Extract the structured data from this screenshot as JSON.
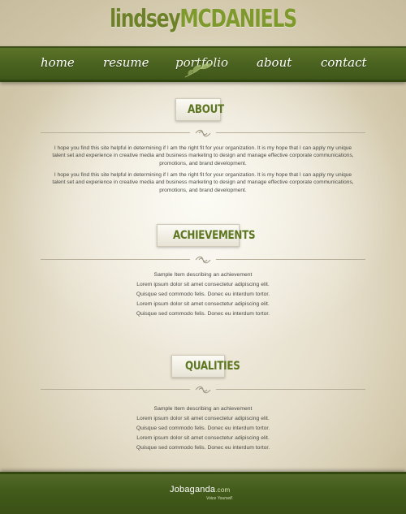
{
  "header": {
    "logo_first": "lindsey",
    "logo_last": "MCDANIELS"
  },
  "nav": {
    "items": [
      {
        "label": "home"
      },
      {
        "label": "resume"
      },
      {
        "label": "portfolio"
      },
      {
        "label": "about"
      },
      {
        "label": "contact"
      }
    ],
    "active": "portfolio"
  },
  "about": {
    "heading": "ABOUT",
    "paragraphs": [
      "I hope you find this site helpful in determining if I am the right fit for your organization.  It is my hope that I can apply my unique talent set and experience in creative media and business marketing to design and manage effective corporate communications, promotions, and brand development.",
      "I hope you find this site helpful in determining if I am the right fit for your organization.  It is my hope that I can apply my unique talent set and experience in creative media and business marketing to design and manage effective corporate communications, promotions, and brand development."
    ]
  },
  "achievements": {
    "heading": "ACHIEVEMENTS",
    "items": [
      "Sample Item describing an achievement",
      "Lorem ipsum dolor sit amet consectetur adipiscing elit.",
      "Quisque sed commodo felis. Donec eu interdum tortor.",
      "Lorem ipsum dolor sit amet consectetur adipiscing elit.",
      "Quisque sed commodo felis. Donec eu interdum tortor."
    ]
  },
  "qualities": {
    "heading": "QUALITIES",
    "items": [
      "Sample Item describing an achievement",
      "Lorem ipsum dolor sit amet consectetur adipiscing elit.",
      "Quisque sed commodo felis. Donec eu interdum tortor.",
      "Lorem ipsum dolor sit amet consectetur adipiscing elit.",
      "Quisque sed commodo felis. Donec eu interdum tortor."
    ]
  },
  "footer": {
    "brand": "Jobaganda",
    "tld": ".com",
    "tagline": "Voice Yourself."
  },
  "colors": {
    "brand_green": "#4c6420",
    "logo_green": "#6d8228",
    "heading_green": "#5d7620",
    "paper": "#ece6d6"
  }
}
